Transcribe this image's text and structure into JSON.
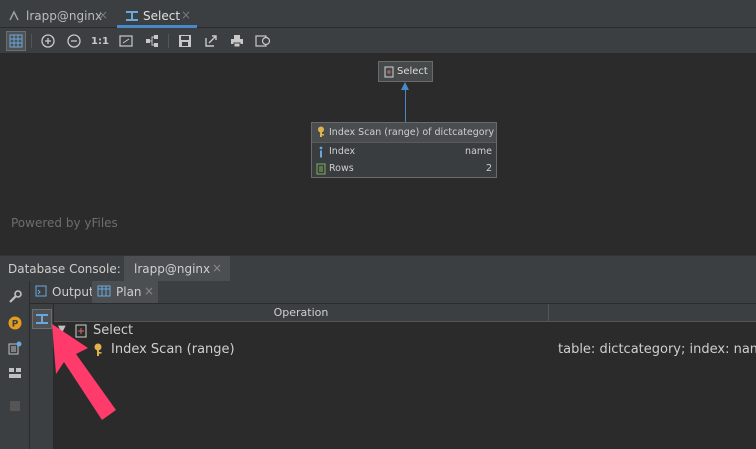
{
  "editor_tabs": [
    {
      "label": "lrapp@nginx",
      "icon": "connection-icon",
      "active": false
    },
    {
      "label": "Select",
      "icon": "explain-plan-icon",
      "active": true
    }
  ],
  "toolbar": {
    "items": [
      "grid-view-icon",
      "zoom-in-icon",
      "zoom-out-icon",
      "actual-size",
      "fit-content-icon",
      "layout-icon",
      "save-icon",
      "export-icon",
      "print-icon",
      "settings-icon"
    ],
    "actual_size_label": "1:1"
  },
  "diagram": {
    "root_node": {
      "label": "Select"
    },
    "child_node": {
      "title": "Index Scan (range) of dictcategory",
      "rows": [
        {
          "key": "Index",
          "value": "name",
          "icon": "info-icon"
        },
        {
          "key": "Rows",
          "value": "2",
          "icon": "rows-icon"
        }
      ]
    },
    "watermark": "Powered by yFiles"
  },
  "console": {
    "title": "Database Console:",
    "tab_label": "lrapp@nginx",
    "inner_tabs": [
      {
        "label": "Output",
        "active": false
      },
      {
        "label": "Plan",
        "active": true
      }
    ]
  },
  "plan": {
    "columns": [
      "Operation"
    ],
    "rows": [
      {
        "operation": "Select",
        "info": "",
        "expanded": true
      },
      {
        "operation": "Index Scan (range)",
        "info": "table: dictcategory; index: name"
      }
    ]
  },
  "colors": {
    "background": "#2b2b2b",
    "panel": "#3c3f41",
    "accent": "#4a88c7",
    "annotation_arrow": "#ff3b6b"
  }
}
